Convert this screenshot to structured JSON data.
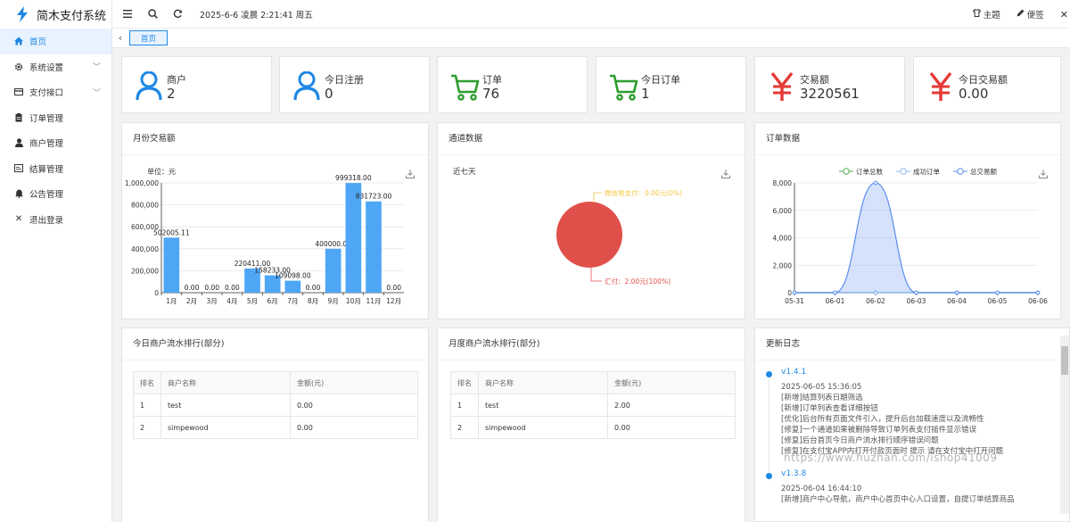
{
  "app": {
    "title": "简木支付系统"
  },
  "sidebar": {
    "items": [
      {
        "label": "首页",
        "icon": "home-icon",
        "active": true
      },
      {
        "label": "系统设置",
        "icon": "gear-icon",
        "has_children": true
      },
      {
        "label": "支付接口",
        "icon": "card-icon",
        "has_children": true
      },
      {
        "label": "订单管理",
        "icon": "clipboard-icon"
      },
      {
        "label": "商户管理",
        "icon": "user-icon"
      },
      {
        "label": "结算管理",
        "icon": "wallet-icon"
      },
      {
        "label": "公告管理",
        "icon": "bell-icon"
      },
      {
        "label": "退出登录",
        "icon": "close-icon"
      }
    ]
  },
  "header": {
    "datetime": "2025-6-6 凌晨 2:21:41 周五",
    "theme_label": "主题",
    "notes_label": "便签"
  },
  "tabs": [
    {
      "label": "首页",
      "active": true
    }
  ],
  "stats": [
    {
      "label": "商户",
      "value": "2",
      "icon": "user-icon",
      "color": "#1e88e5"
    },
    {
      "label": "今日注册",
      "value": "0",
      "icon": "user-icon",
      "color": "#1e88e5"
    },
    {
      "label": "订单",
      "value": "76",
      "icon": "cart-icon",
      "color": "#2e9c2e"
    },
    {
      "label": "今日订单",
      "value": "1",
      "icon": "cart-icon",
      "color": "#2e9c2e"
    },
    {
      "label": "交易额",
      "value": "3220561",
      "icon": "yen-icon",
      "color": "#e53935"
    },
    {
      "label": "今日交易额",
      "value": "0.00",
      "icon": "yen-icon",
      "color": "#e53935"
    }
  ],
  "monthly": {
    "title": "月份交易额",
    "unit_label": "单位：元",
    "y_tick_labels": [
      "0",
      "200,000",
      "400,000",
      "600,000",
      "800,000",
      "1,000,000"
    ]
  },
  "channel": {
    "title": "通道数据",
    "subtitle": "近七天",
    "wechat_label": "微信易支付：0.00元(0%)",
    "huifu_label": "汇付：2.00元(100%)"
  },
  "orders": {
    "title": "订单数据",
    "legend": [
      "订单总数",
      "成功订单",
      "总交易额"
    ],
    "y_tick_labels": [
      "0",
      "2,000",
      "4,000",
      "6,000",
      "8,000"
    ]
  },
  "chart_data": [
    {
      "type": "bar",
      "title": "月份交易额",
      "ylabel": "单位：元",
      "categories": [
        "1月",
        "2月",
        "3月",
        "4月",
        "5月",
        "6月",
        "7月",
        "8月",
        "9月",
        "10月",
        "11月",
        "12月"
      ],
      "values": [
        502005.11,
        0,
        0,
        0,
        220411,
        158233,
        109098,
        0,
        400000,
        999318,
        831723,
        0
      ],
      "value_labels": [
        "502005.11",
        "0.00",
        "0.00",
        "0.00",
        "220411.00",
        "158233.00",
        "109098.00",
        "0.00",
        "400000.00",
        "999318.00",
        "831723.00",
        "0.00"
      ],
      "ylim": [
        0,
        1000000
      ],
      "color": "#4ea6f5"
    },
    {
      "type": "pie",
      "title": "通道数据",
      "subtitle": "近七天",
      "slices": [
        {
          "name": "微信易支付",
          "value": 0.0,
          "color": "#f5c842"
        },
        {
          "name": "汇付",
          "value": 2.0,
          "color": "#e0504a"
        }
      ]
    },
    {
      "type": "area",
      "title": "订单数据",
      "categories": [
        "05-31",
        "06-01",
        "06-02",
        "06-03",
        "06-04",
        "06-05",
        "06-06"
      ],
      "series": [
        {
          "name": "订单总数",
          "values": [
            0,
            0,
            0,
            0,
            0,
            0,
            0
          ],
          "color": "#4caf50"
        },
        {
          "name": "成功订单",
          "values": [
            0,
            0,
            0,
            0,
            0,
            0,
            0
          ],
          "color": "#90b8f0"
        },
        {
          "name": "总交易额",
          "values": [
            0,
            0,
            8000,
            0,
            0,
            0,
            0
          ],
          "color": "#5b8def"
        }
      ],
      "ylim": [
        0,
        8000
      ]
    }
  ],
  "today_rank": {
    "title": "今日商户流水排行(部分)",
    "columns": [
      "排名",
      "商户名称",
      "金额(元)"
    ],
    "rows": [
      [
        "1",
        "test",
        "0.00"
      ],
      [
        "2",
        "simpewood",
        "0.00"
      ]
    ]
  },
  "month_rank": {
    "title": "月度商户流水排行(部分)",
    "columns": [
      "排名",
      "商户名称",
      "金额(元)"
    ],
    "rows": [
      [
        "1",
        "test",
        "2.00"
      ],
      [
        "2",
        "simpewood",
        "0.00"
      ]
    ]
  },
  "changelog": {
    "title": "更新日志",
    "entries": [
      {
        "version": "v1.4.1",
        "time": "2025-06-05 15:36:05",
        "lines": [
          "[新增]结算列表日期筛选",
          "[新增]订单列表查看详细按钮",
          "[优化]后台所有页面文件引入，提升后台加载速度以及流畅性",
          "[修复]一个通道如果被删除导致订单列表支付插件显示错误",
          "[修复]后台首页今日商户流水排行顺序错误问题",
          "[修复]在支付宝APP内打开付款页面时 提示 请在支付宝中打开问题"
        ]
      },
      {
        "version": "v1.3.8",
        "time": "2025-06-04 16:44:10",
        "lines": [
          "[新增]商户中心导航，商户中心首页中心入口设置，自提订单结算商品"
        ]
      }
    ],
    "watermark": "https://www.huzhan.com/ishop41009"
  }
}
